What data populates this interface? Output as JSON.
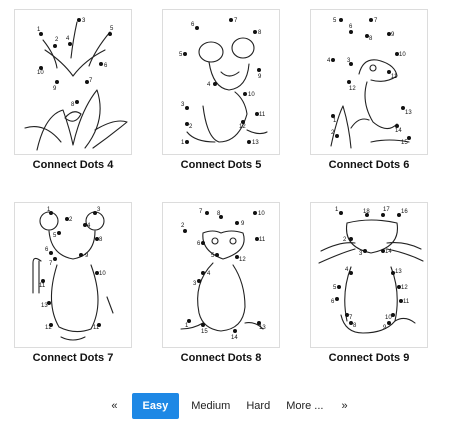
{
  "cards": [
    {
      "title": "Connect Dots 4"
    },
    {
      "title": "Connect Dots 5"
    },
    {
      "title": "Connect Dots 6"
    },
    {
      "title": "Connect Dots 7"
    },
    {
      "title": "Connect Dots 8"
    },
    {
      "title": "Connect Dots 9"
    }
  ],
  "pager": {
    "prev": "«",
    "items": [
      "Easy",
      "Medium",
      "Hard",
      "More ..."
    ],
    "active": "Easy",
    "next": "»",
    "active_color": "#1e88e5"
  }
}
